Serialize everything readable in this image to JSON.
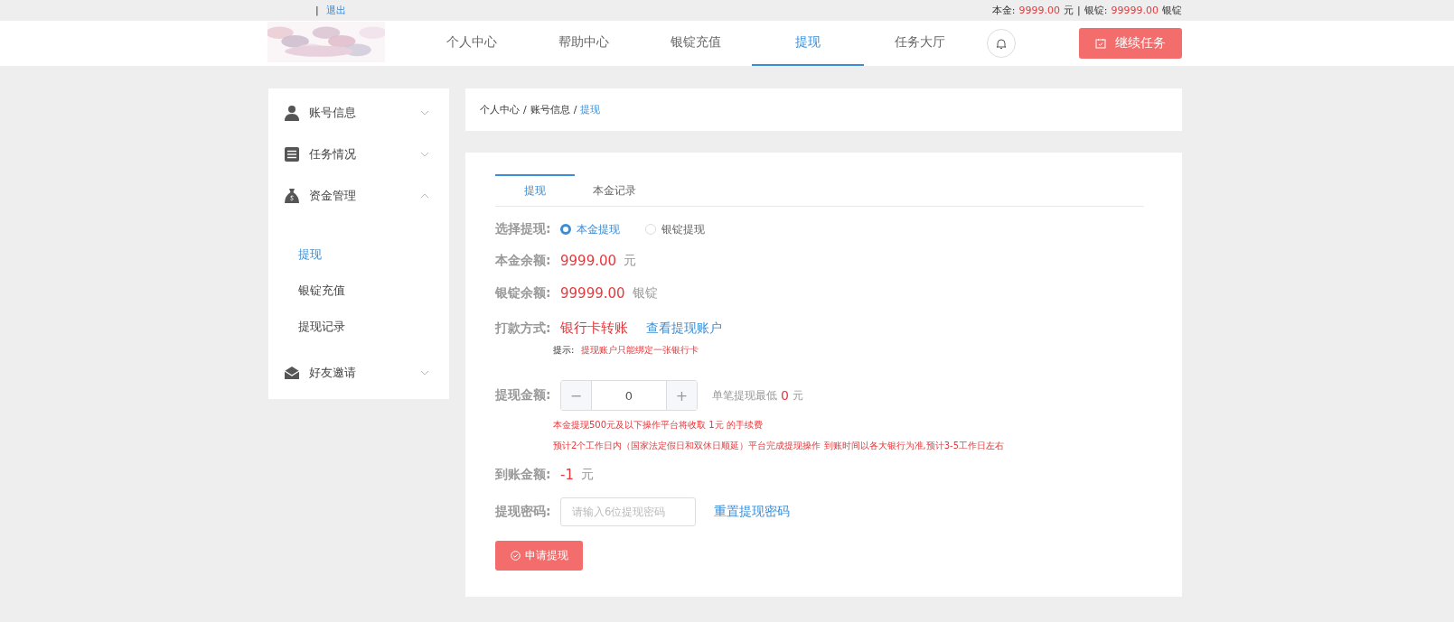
{
  "top_bar": {
    "separator": "|",
    "logout_link": "退出",
    "principal_label": "本金:",
    "principal_value": "9999.00",
    "principal_unit": "元",
    "divider": "|",
    "ingot_label": "银锭:",
    "ingot_value": "99999.00",
    "ingot_unit": "银锭"
  },
  "logo": {
    "kind": "picture"
  },
  "nav": {
    "items": [
      {
        "label": "个人中心",
        "selected": false
      },
      {
        "label": "帮助中心",
        "selected": false
      },
      {
        "label": "银锭充值",
        "selected": false
      },
      {
        "label": "提现",
        "selected": true
      },
      {
        "label": "任务大厅",
        "selected": false
      }
    ],
    "continue_button": "继续任务"
  },
  "sidebar": {
    "groups": [
      {
        "label": "账号信息",
        "expanded": false
      },
      {
        "label": "任务情况",
        "expanded": false
      },
      {
        "label": "资金管理",
        "expanded": true,
        "children": [
          {
            "label": "提现",
            "selected": true
          },
          {
            "label": "银锭充值",
            "selected": false
          },
          {
            "label": "提现记录",
            "selected": false
          }
        ]
      },
      {
        "label": "好友邀请",
        "expanded": false
      }
    ]
  },
  "breadcrumb": {
    "separator": "/",
    "items": [
      {
        "label": "个人中心",
        "current": false
      },
      {
        "label": "账号信息",
        "current": false
      },
      {
        "label": "提现",
        "current": true
      }
    ]
  },
  "tabs": [
    {
      "label": "提现",
      "selected": true
    },
    {
      "label": "本金记录",
      "selected": false
    }
  ],
  "withdraw_type": {
    "label": "选择提现:",
    "options": [
      {
        "label": "本金提现",
        "selected": true
      },
      {
        "label": "银锭提现",
        "selected": false
      }
    ]
  },
  "principal_balance": {
    "label": "本金余额:",
    "value": "9999.00",
    "unit": "元"
  },
  "ingot_balance": {
    "label": "银锭余额:",
    "value": "99999.00",
    "unit": "银锭"
  },
  "payment_method": {
    "label": "打款方式:",
    "value": "银行卡转账",
    "link": "查看提现账户"
  },
  "hint": {
    "label": "提示:",
    "text": "提现账户只能绑定一张银行卡"
  },
  "amount": {
    "label": "提现金额:",
    "minus": "−",
    "value": "0",
    "plus": "+",
    "min_note": "单笔提现最低",
    "min_value": "0",
    "min_unit": "元"
  },
  "notes": [
    "本金提现500元及以下操作平台将收取 1元 的手续费",
    "预计2个工作日内（国家法定假日和双休日顺延）平台完成提现操作 到账时间以各大银行为准,预计3-5工作日左右"
  ],
  "arrival": {
    "label": "到账金额:",
    "value": "-1",
    "unit": "元"
  },
  "password": {
    "label": "提现密码:",
    "placeholder": "请输入6位提现密码",
    "reset_link": "重置提现密码"
  },
  "submit_button": "申请提现"
}
